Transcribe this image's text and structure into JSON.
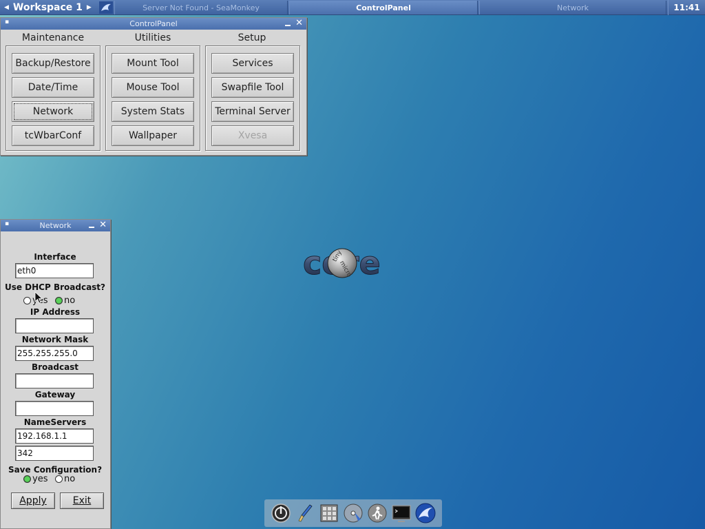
{
  "taskbar": {
    "workspace": "Workspace 1",
    "tasks": [
      {
        "label": "Server Not Found - SeaMonkey",
        "active": false
      },
      {
        "label": "ControlPanel",
        "active": true
      },
      {
        "label": "Network",
        "active": false
      }
    ],
    "clock": "11:41"
  },
  "control_panel": {
    "title": "ControlPanel",
    "columns": [
      {
        "heading": "Maintenance",
        "buttons": [
          "Backup/Restore",
          "Date/Time",
          "Network",
          "tcWbarConf"
        ]
      },
      {
        "heading": "Utilities",
        "buttons": [
          "Mount Tool",
          "Mouse Tool",
          "System Stats",
          "Wallpaper"
        ]
      },
      {
        "heading": "Setup",
        "buttons": [
          "Services",
          "Swapfile Tool",
          "Terminal Server",
          "Xvesa"
        ]
      }
    ],
    "focused_button": "Network",
    "disabled_button": "Xvesa"
  },
  "network": {
    "title": "Network",
    "interface_label": "Interface",
    "interface_value": "eth0",
    "dhcp_label": "Use DHCP Broadcast?",
    "dhcp_yes": "yes",
    "dhcp_no": "no",
    "dhcp_selected": "no",
    "ip_label": "IP Address",
    "ip_value": "",
    "mask_label": "Network Mask",
    "mask_value": "255.255.255.0",
    "broadcast_label": "Broadcast",
    "broadcast_value": "",
    "gateway_label": "Gateway",
    "gateway_value": "",
    "nameservers_label": "NameServers",
    "nameserver1": "192.168.1.1",
    "nameserver2": "342",
    "save_label": "Save Configuration?",
    "save_yes": "yes",
    "save_no": "no",
    "save_selected": "yes",
    "apply_label": "Apply",
    "exit_label": "Exit"
  },
  "desktop": {
    "logo_text": "core",
    "logo_subtext_1": "tiny",
    "logo_subtext_2": "micro"
  },
  "dock": {
    "icons": [
      "power-icon",
      "paint-brush-icon",
      "calculator-icon",
      "install-disc-icon",
      "runner-icon",
      "terminal-icon",
      "seamonkey-icon"
    ]
  },
  "colors": {
    "taskbar": "#4a6fad",
    "window_bg": "#d6d6d6",
    "radio_selected": "#4fc94f",
    "desktop_start": "#7ec6cc",
    "desktop_end": "#165aa6"
  }
}
